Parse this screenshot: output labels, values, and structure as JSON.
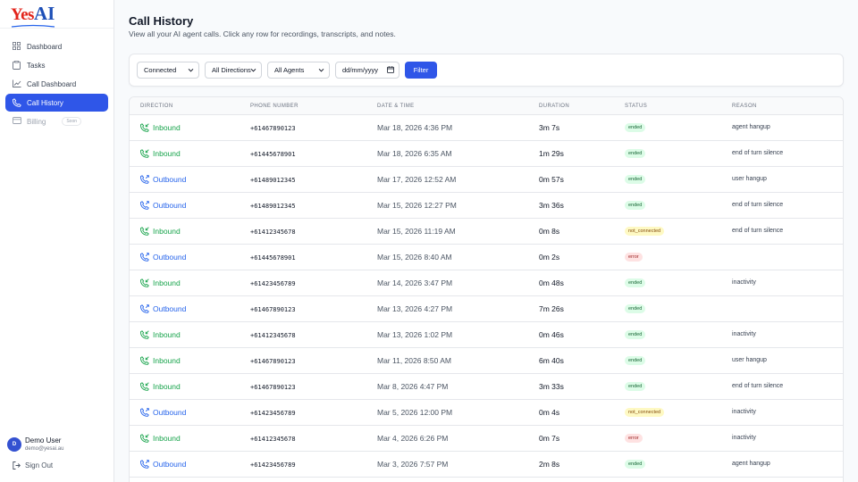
{
  "brand": {
    "logo_text_1": "Yes",
    "logo_text_2": "AI"
  },
  "sidebar": {
    "items": [
      {
        "label": "Dashboard",
        "icon": "grid-icon",
        "active": false
      },
      {
        "label": "Tasks",
        "icon": "clipboard-icon",
        "active": false
      },
      {
        "label": "Call Dashboard",
        "icon": "chart-icon",
        "active": false
      },
      {
        "label": "Call History",
        "icon": "phone-icon",
        "active": true
      },
      {
        "label": "Billing",
        "icon": "card-icon",
        "active": false,
        "badge": "Soon"
      }
    ],
    "user": {
      "initial": "D",
      "name": "Demo User",
      "email": "demo@yesai.au"
    },
    "signout": "Sign Out"
  },
  "page": {
    "title": "Call History",
    "subtitle": "View all your AI agent calls. Click any row for recordings, transcripts, and notes."
  },
  "filters": {
    "status": "Connected",
    "direction": "All Directions",
    "agent": "All Agents",
    "date_placeholder": "dd/mm/yyyy",
    "button": "Filter"
  },
  "table": {
    "headers": [
      "DIRECTION",
      "PHONE NUMBER",
      "DATE & TIME",
      "DURATION",
      "STATUS",
      "REASON"
    ],
    "rows": [
      {
        "direction": "Inbound",
        "phone": "+61467890123",
        "datetime": "Mar 18, 2026 4:36 PM",
        "duration": "3m 7s",
        "status": "ended",
        "reason": "agent hangup"
      },
      {
        "direction": "Inbound",
        "phone": "+61445678901",
        "datetime": "Mar 18, 2026 6:35 AM",
        "duration": "1m 29s",
        "status": "ended",
        "reason": "end of turn silence"
      },
      {
        "direction": "Outbound",
        "phone": "+61489012345",
        "datetime": "Mar 17, 2026 12:52 AM",
        "duration": "0m 57s",
        "status": "ended",
        "reason": "user hangup"
      },
      {
        "direction": "Outbound",
        "phone": "+61489012345",
        "datetime": "Mar 15, 2026 12:27 PM",
        "duration": "3m 36s",
        "status": "ended",
        "reason": "end of turn silence"
      },
      {
        "direction": "Inbound",
        "phone": "+61412345678",
        "datetime": "Mar 15, 2026 11:19 AM",
        "duration": "0m 8s",
        "status": "not_connected",
        "reason": "end of turn silence"
      },
      {
        "direction": "Outbound",
        "phone": "+61445678901",
        "datetime": "Mar 15, 2026 8:40 AM",
        "duration": "0m 2s",
        "status": "error",
        "reason": ""
      },
      {
        "direction": "Inbound",
        "phone": "+61423456789",
        "datetime": "Mar 14, 2026 3:47 PM",
        "duration": "0m 48s",
        "status": "ended",
        "reason": "inactivity"
      },
      {
        "direction": "Outbound",
        "phone": "+61467890123",
        "datetime": "Mar 13, 2026 4:27 PM",
        "duration": "7m 26s",
        "status": "ended",
        "reason": ""
      },
      {
        "direction": "Inbound",
        "phone": "+61412345678",
        "datetime": "Mar 13, 2026 1:02 PM",
        "duration": "0m 46s",
        "status": "ended",
        "reason": "inactivity"
      },
      {
        "direction": "Inbound",
        "phone": "+61467890123",
        "datetime": "Mar 11, 2026 8:50 AM",
        "duration": "6m 40s",
        "status": "ended",
        "reason": "user hangup"
      },
      {
        "direction": "Inbound",
        "phone": "+61467890123",
        "datetime": "Mar 8, 2026 4:47 PM",
        "duration": "3m 33s",
        "status": "ended",
        "reason": "end of turn silence"
      },
      {
        "direction": "Outbound",
        "phone": "+61423456789",
        "datetime": "Mar 5, 2026 12:00 PM",
        "duration": "0m 4s",
        "status": "not_connected",
        "reason": "inactivity"
      },
      {
        "direction": "Inbound",
        "phone": "+61412345678",
        "datetime": "Mar 4, 2026 6:26 PM",
        "duration": "0m 7s",
        "status": "error",
        "reason": "inactivity"
      },
      {
        "direction": "Outbound",
        "phone": "+61423456789",
        "datetime": "Mar 3, 2026 7:57 PM",
        "duration": "2m 8s",
        "status": "ended",
        "reason": "agent hangup"
      }
    ]
  },
  "colors": {
    "accent": "#2f56e8",
    "inbound": "#16a34a",
    "outbound": "#2563eb"
  }
}
